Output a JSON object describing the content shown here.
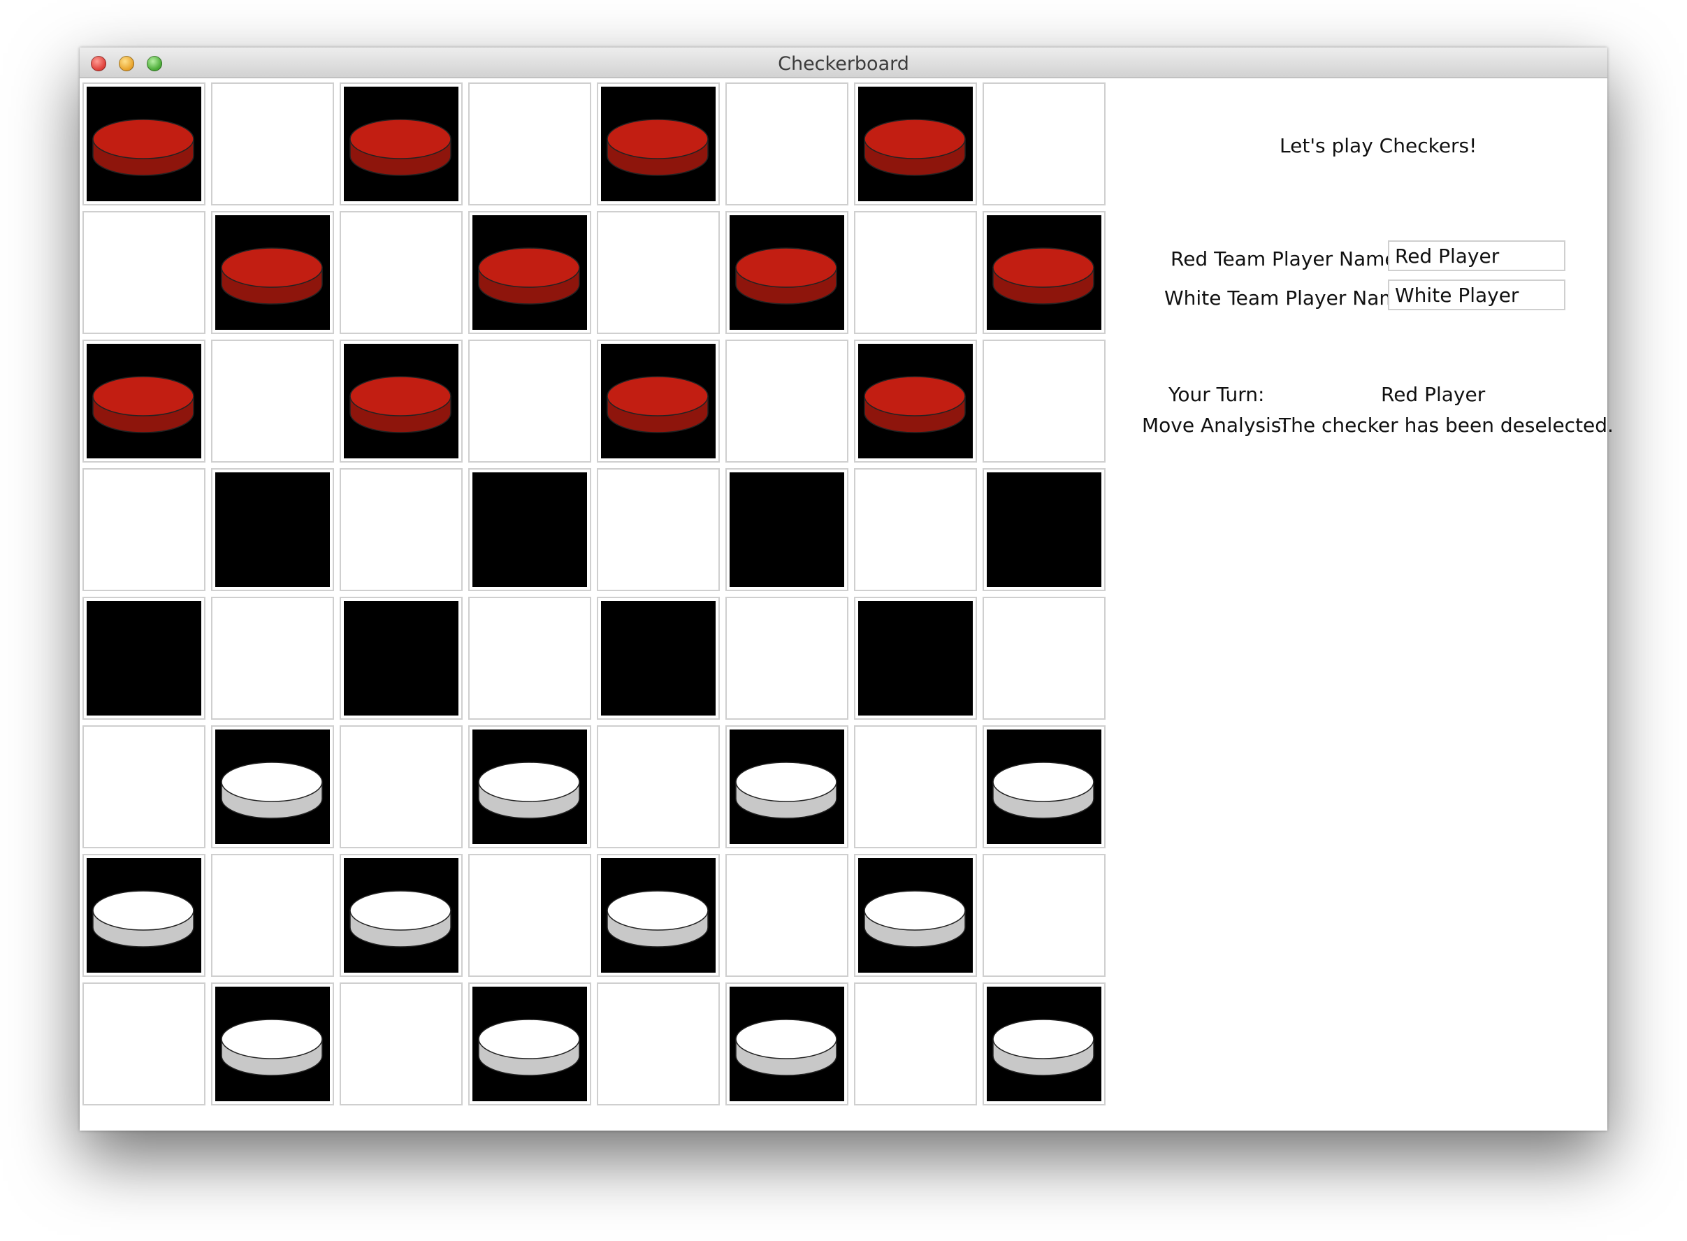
{
  "window": {
    "title": "Checkerboard"
  },
  "board": {
    "rows": [
      [
        "red",
        "",
        "red",
        "",
        "red",
        "",
        "red",
        ""
      ],
      [
        "",
        "red",
        "",
        "red",
        "",
        "red",
        "",
        "red"
      ],
      [
        "red",
        "",
        "red",
        "",
        "red",
        "",
        "red",
        ""
      ],
      [
        "",
        "empty",
        "",
        "empty",
        "",
        "empty",
        "",
        "empty"
      ],
      [
        "empty",
        "",
        "empty",
        "",
        "empty",
        "",
        "empty",
        ""
      ],
      [
        "",
        "white",
        "",
        "white",
        "",
        "white",
        "",
        "white"
      ],
      [
        "white",
        "",
        "white",
        "",
        "white",
        "",
        "white",
        ""
      ],
      [
        "",
        "white",
        "",
        "white",
        "",
        "white",
        "",
        "white"
      ]
    ]
  },
  "panel": {
    "welcome": "Let's play Checkers!",
    "red_label": "Red Team Player Name:",
    "red_value": "Red Player",
    "white_label": "White Team Player Name:",
    "white_value": "White Player",
    "turn_label": "Your Turn:",
    "turn_value": "Red Player",
    "analysis_label": "Move Analysis:",
    "analysis_value": "The checker has been deselected."
  },
  "colors": {
    "red_piece_top": "#c21e12",
    "red_piece_side": "#8e150c",
    "white_piece_top": "#ffffff",
    "white_piece_side": "#c8c8c8",
    "dark_square": "#000000"
  }
}
